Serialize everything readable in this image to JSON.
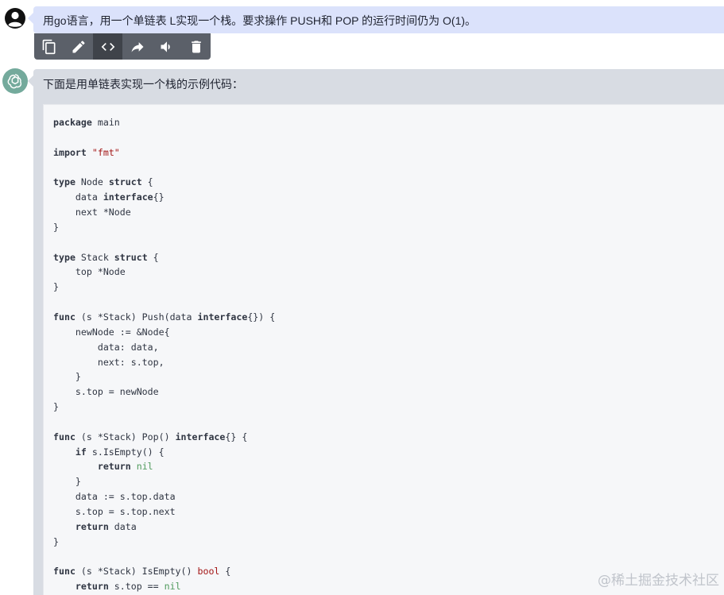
{
  "user": {
    "avatar_icon": "user-circle-icon",
    "message": "用go语言，用一个单链表 L实现一个栈。要求操作 PUSH和 POP 的运行时间仍为 O(1)。"
  },
  "toolbar": {
    "buttons": [
      {
        "icon": "copy-icon",
        "active": false
      },
      {
        "icon": "edit-pencil-icon",
        "active": false
      },
      {
        "icon": "code-brackets-icon",
        "active": true
      },
      {
        "icon": "share-arrow-icon",
        "active": false
      },
      {
        "icon": "speaker-icon",
        "active": false
      },
      {
        "icon": "trash-icon",
        "active": false
      }
    ]
  },
  "assistant": {
    "avatar_icon": "openai-logo-icon",
    "intro": "下面是用单链表实现一个栈的示例代码：",
    "code_lines": [
      [
        {
          "t": "package",
          "c": "kw"
        },
        {
          "t": " main"
        }
      ],
      [],
      [
        {
          "t": "import",
          "c": "kw"
        },
        {
          "t": " "
        },
        {
          "t": "\"fmt\"",
          "c": "str"
        }
      ],
      [],
      [
        {
          "t": "type",
          "c": "kw"
        },
        {
          "t": " Node "
        },
        {
          "t": "struct",
          "c": "kw"
        },
        {
          "t": " {"
        }
      ],
      [
        {
          "t": "    data "
        },
        {
          "t": "interface",
          "c": "kw"
        },
        {
          "t": "{}"
        }
      ],
      [
        {
          "t": "    next *Node"
        }
      ],
      [
        {
          "t": "}"
        }
      ],
      [],
      [
        {
          "t": "type",
          "c": "kw"
        },
        {
          "t": " Stack "
        },
        {
          "t": "struct",
          "c": "kw"
        },
        {
          "t": " {"
        }
      ],
      [
        {
          "t": "    top *Node"
        }
      ],
      [
        {
          "t": "}"
        }
      ],
      [],
      [
        {
          "t": "func",
          "c": "kw"
        },
        {
          "t": " (s *Stack) Push(data "
        },
        {
          "t": "interface",
          "c": "kw"
        },
        {
          "t": "{}) {"
        }
      ],
      [
        {
          "t": "    newNode := &Node{"
        }
      ],
      [
        {
          "t": "        data: data,"
        }
      ],
      [
        {
          "t": "        next: s.top,"
        }
      ],
      [
        {
          "t": "    }"
        }
      ],
      [
        {
          "t": "    s.top = newNode"
        }
      ],
      [
        {
          "t": "}"
        }
      ],
      [],
      [
        {
          "t": "func",
          "c": "kw"
        },
        {
          "t": " (s *Stack) Pop() "
        },
        {
          "t": "interface",
          "c": "kw"
        },
        {
          "t": "{} {"
        }
      ],
      [
        {
          "t": "    "
        },
        {
          "t": "if",
          "c": "kw"
        },
        {
          "t": " s.IsEmpty() {"
        }
      ],
      [
        {
          "t": "        "
        },
        {
          "t": "return",
          "c": "kw"
        },
        {
          "t": " "
        },
        {
          "t": "nil",
          "c": "lit"
        }
      ],
      [
        {
          "t": "    }"
        }
      ],
      [
        {
          "t": "    data := s.top.data"
        }
      ],
      [
        {
          "t": "    s.top = s.top.next"
        }
      ],
      [
        {
          "t": "    "
        },
        {
          "t": "return",
          "c": "kw"
        },
        {
          "t": " data"
        }
      ],
      [
        {
          "t": "}"
        }
      ],
      [],
      [
        {
          "t": "func",
          "c": "kw"
        },
        {
          "t": " (s *Stack) IsEmpty() "
        },
        {
          "t": "bool",
          "c": "ty"
        },
        {
          "t": " {"
        }
      ],
      [
        {
          "t": "    "
        },
        {
          "t": "return",
          "c": "kw"
        },
        {
          "t": " s.top == "
        },
        {
          "t": "nil",
          "c": "lit"
        }
      ]
    ]
  },
  "watermark": "@稀土掘金技术社区",
  "colors": {
    "user_bubble": "#dbe2fb",
    "assistant_bubble": "#d8dce3",
    "code_background": "#f6f7f9",
    "toolbar": "#5b6069",
    "assistant_avatar": "#74aa9c"
  }
}
